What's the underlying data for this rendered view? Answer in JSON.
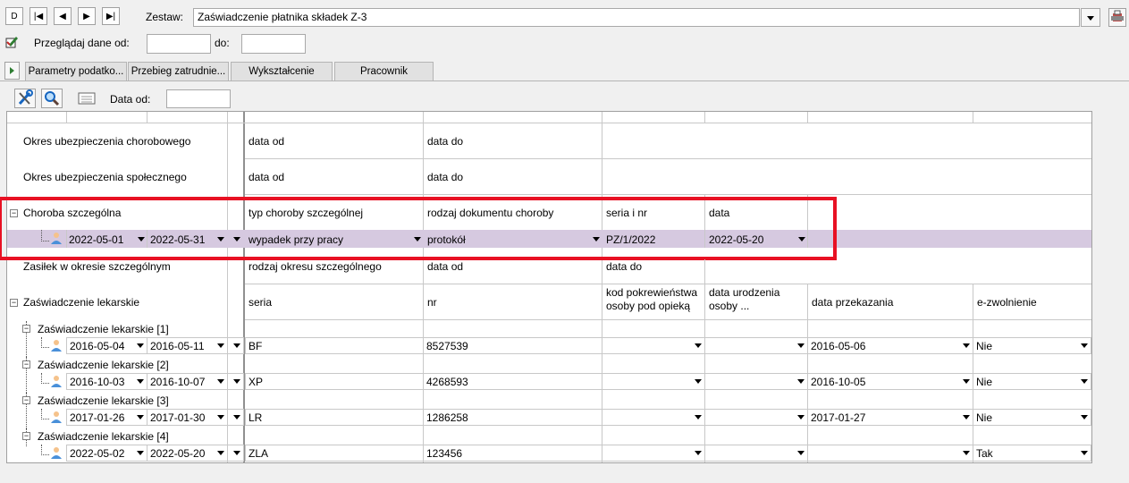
{
  "nav": {
    "first": "|◀",
    "prev": "◀",
    "next": "▶",
    "last": "▶|",
    "top": "D"
  },
  "zestaw": {
    "label": "Zestaw:",
    "value": "Zaświadczenie płatnika składek Z-3"
  },
  "browse": {
    "label": "Przeglądaj dane od:",
    "to_label": "do:"
  },
  "tabs": [
    "Parametry podatko...",
    "Przebieg zatrudnie...",
    "Wykształcenie",
    "Pracownik"
  ],
  "toolbar": {
    "date_label": "Data od:"
  },
  "sections": {
    "okres_chorobowy": {
      "label": "Okres ubezpieczenia chorobowego",
      "col1": "data od",
      "col2": "data do"
    },
    "okres_spoleczny": {
      "label": "Okres ubezpieczenia społecznego",
      "col1": "data od",
      "col2": "data do"
    },
    "choroba": {
      "label": "Choroba szczególna",
      "col1": "typ choroby szczególnej",
      "col2": "rodzaj dokumentu choroby",
      "col3": "seria i nr",
      "col4": "data",
      "row": {
        "from": "2022-05-01",
        "to": "2022-05-31",
        "typ": "wypadek przy pracy",
        "rodzaj": "protokół",
        "seria": "PZ/1/2022",
        "data": "2022-05-20"
      }
    },
    "zasilek": {
      "label": "Zasiłek w okresie szczególnym",
      "col1": "rodzaj okresu szczególnego",
      "col2": "data od",
      "col3": "data do"
    },
    "lekarskie": {
      "label": "Zaświadczenie lekarskie",
      "col1": "seria",
      "col2": "nr",
      "col3a": "kod pokrewieństwa",
      "col3b": "osoby pod opieką",
      "col4a": "data urodzenia",
      "col4b": "osoby ...",
      "col5": "data przekazania",
      "col6": "e-zwolnienie",
      "items": [
        {
          "title": "Zaświadczenie lekarskie [1]",
          "from": "2016-05-04",
          "to": "2016-05-11",
          "seria": "BF",
          "nr": "8527539",
          "data_przekazania": "2016-05-06",
          "ezw": "Nie"
        },
        {
          "title": "Zaświadczenie lekarskie [2]",
          "from": "2016-10-03",
          "to": "2016-10-07",
          "seria": "XP",
          "nr": "4268593",
          "data_przekazania": "2016-10-05",
          "ezw": "Nie"
        },
        {
          "title": "Zaświadczenie lekarskie [3]",
          "from": "2017-01-26",
          "to": "2017-01-30",
          "seria": "LR",
          "nr": "1286258",
          "data_przekazania": "2017-01-27",
          "ezw": "Nie"
        },
        {
          "title": "Zaświadczenie lekarskie [4]",
          "from": "2022-05-02",
          "to": "2022-05-20",
          "seria": "ZLA",
          "nr": "123456",
          "data_przekazania": "",
          "ezw": "Tak"
        }
      ]
    }
  },
  "colors": {
    "highlight": "#e81123",
    "purple_row": "#d6c9e0"
  }
}
